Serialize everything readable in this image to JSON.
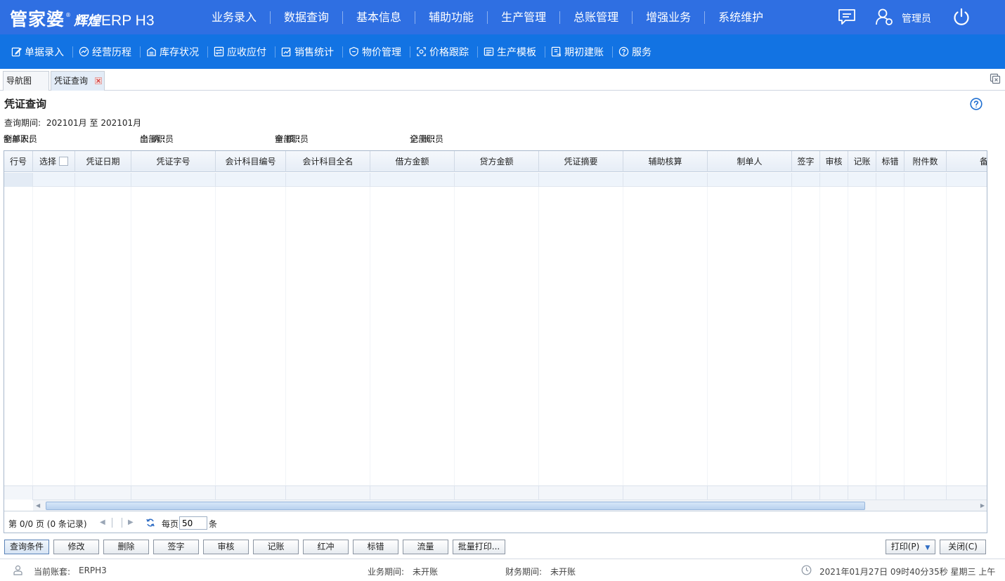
{
  "app": {
    "logo_cn": "管家婆",
    "logo_sub": "辉煌",
    "logo_erp": "ERP H3",
    "logo_reg": "®"
  },
  "main_menu": [
    "业务录入",
    "数据查询",
    "基本信息",
    "辅助功能",
    "生产管理",
    "总账管理",
    "增强业务",
    "系统维护"
  ],
  "user": {
    "name": "管理员"
  },
  "sub_menu": [
    {
      "label": "单据录入",
      "icon": "edit-icon"
    },
    {
      "label": "经营历程",
      "icon": "trend-icon"
    },
    {
      "label": "库存状况",
      "icon": "warehouse-icon"
    },
    {
      "label": "应收应付",
      "icon": "exchange-icon"
    },
    {
      "label": "销售统计",
      "icon": "sales-chart-icon"
    },
    {
      "label": "物价管理",
      "icon": "price-shield-icon"
    },
    {
      "label": "价格跟踪",
      "icon": "price-track-icon"
    },
    {
      "label": "生产模板",
      "icon": "template-icon"
    },
    {
      "label": "期初建账",
      "icon": "opening-book-icon"
    },
    {
      "label": "服务",
      "icon": "question-icon"
    }
  ],
  "tabs": [
    {
      "label": "导航图",
      "active": false
    },
    {
      "label": "凭证查询",
      "active": true
    }
  ],
  "page": {
    "title": "凭证查询",
    "period_label": "查询期间:",
    "period_value": "202101月 至 202101月",
    "filters": {
      "maker_label": "制单人:",
      "maker_value": "全部职员",
      "cashier_label": "出 纳 :",
      "cashier_value": "全部职员",
      "auditor_label": "审 核 :",
      "auditor_value": "全部职员",
      "poster_label": "记 账 :",
      "poster_value": "全部职员"
    }
  },
  "grid": {
    "columns": [
      "行号",
      "选择",
      "凭证日期",
      "凭证字号",
      "会计科目编号",
      "会计科目全名",
      "借方金额",
      "贷方金额",
      "凭证摘要",
      "辅助核算",
      "制单人",
      "签字",
      "审核",
      "记账",
      "标错",
      "附件数",
      "备"
    ],
    "rows": []
  },
  "pager": {
    "summary": "第 0/0 页 (0 条记录)",
    "per_page_label": "每页",
    "per_page_value": "50",
    "per_page_unit": "条"
  },
  "actions": [
    "查询条件",
    "修改",
    "删除",
    "签字",
    "审核",
    "记账",
    "红冲",
    "标错",
    "流量",
    "批量打印..."
  ],
  "right_actions": {
    "print": "打印(P)",
    "close": "关闭(C)"
  },
  "status": {
    "account_label": "当前账套:",
    "account_value": "ERPH3",
    "biz_period_label": "业务期间:",
    "biz_period_value": "未开账",
    "fin_period_label": "财务期间:",
    "fin_period_value": "未开账",
    "datetime": "2021年01月27日 09时40分35秒 星期三 上午"
  },
  "colors": {
    "topbar": "#2f6fe2",
    "subbar": "#1273e3",
    "accent": "#2e6cc4"
  }
}
